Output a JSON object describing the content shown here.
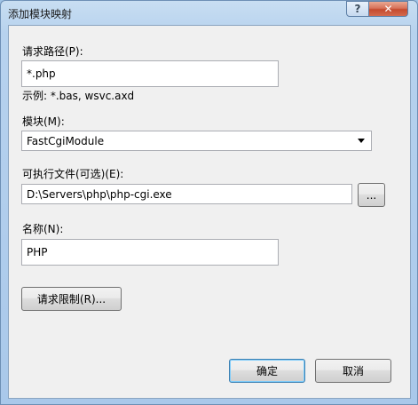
{
  "window": {
    "title": "添加模块映射",
    "help_glyph": "?",
    "close_glyph": "✕"
  },
  "request_path": {
    "label": "请求路径(P):",
    "value": "*.php",
    "example": "示例: *.bas, wsvc.axd"
  },
  "module": {
    "label": "模块(M):",
    "selected": "FastCgiModule"
  },
  "executable": {
    "label": "可执行文件(可选)(E):",
    "value": "D:\\Servers\\php\\php-cgi.exe",
    "browse_label": "..."
  },
  "name": {
    "label": "名称(N):",
    "value": "PHP"
  },
  "buttons": {
    "request_restrictions": "请求限制(R)...",
    "ok": "确定",
    "cancel": "取消"
  }
}
